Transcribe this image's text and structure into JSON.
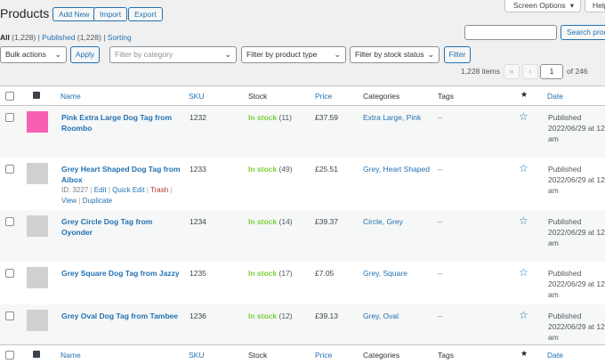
{
  "header": {
    "title": "Products",
    "add_new": "Add New",
    "import": "Import",
    "export": "Export",
    "screen_options": "Screen Options",
    "help": "Help"
  },
  "views": {
    "all": "All",
    "all_count": "(1,228)",
    "published": "Published",
    "published_count": "(1,228)",
    "sorting": "Sorting",
    "sep": "|"
  },
  "search": {
    "placeholder": "",
    "button": "Search products"
  },
  "filters": {
    "bulk": "Bulk actions",
    "apply": "Apply",
    "category": "Filter by category",
    "product_type": "Filter by product type",
    "stock_status": "Filter by stock status",
    "filter": "Filter"
  },
  "pagination": {
    "items": "1,228 items",
    "first": "«",
    "prev": "‹",
    "current": "1",
    "of": "of 246"
  },
  "columns": {
    "name": "Name",
    "sku": "SKU",
    "stock": "Stock",
    "price": "Price",
    "categories": "Categories",
    "tags": "Tags",
    "featured_icon": "star-filled-icon",
    "date": "Date"
  },
  "colors": {
    "accent": "#2271b1",
    "in_stock": "#7ad03a",
    "trash": "#b32d2e",
    "pink_thumb": "#f75fb3",
    "grey_thumb": "#d0d0d0"
  },
  "products": [
    {
      "name": "Pink Extra Large Dog Tag from Roombo",
      "sku": "1232",
      "stock_label": "In stock",
      "stock_qty": "(11)",
      "price": "£37.59",
      "categories": "Extra Large, Pink",
      "tags": "–",
      "date_status": "Published",
      "date": "2022/06/29 at 12:",
      "date_suffix": "am"
    },
    {
      "name": "Grey Heart Shaped Dog Tag from Aibox",
      "sku": "1233",
      "stock_label": "In stock",
      "stock_qty": "(49)",
      "price": "£25.51",
      "categories": "Grey, Heart Shaped",
      "tags": "–",
      "date_status": "Published",
      "date": "2022/06/29 at 12:",
      "date_suffix": "am",
      "row_actions": {
        "id": "ID: 3227",
        "edit": "Edit",
        "quick_edit": "Quick Edit",
        "trash": "Trash",
        "view": "View",
        "duplicate": "Duplicate"
      }
    },
    {
      "name": "Grey Circle Dog Tag from Oyonder",
      "sku": "1234",
      "stock_label": "In stock",
      "stock_qty": "(14)",
      "price": "£39.37",
      "categories": "Circle, Grey",
      "tags": "–",
      "date_status": "Published",
      "date": "2022/06/29 at 12:",
      "date_suffix": "am"
    },
    {
      "name": "Grey Square Dog Tag from Jazzy",
      "sku": "1235",
      "stock_label": "In stock",
      "stock_qty": "(17)",
      "price": "£7.05",
      "categories": "Grey, Square",
      "tags": "–",
      "date_status": "Published",
      "date": "2022/06/29 at 12:",
      "date_suffix": "am"
    },
    {
      "name": "Grey Oval Dog Tag from Tambee",
      "sku": "1236",
      "stock_label": "In stock",
      "stock_qty": "(12)",
      "price": "£39.13",
      "categories": "Grey, Oval",
      "tags": "–",
      "date_status": "Published",
      "date": "2022/06/29 at 12:",
      "date_suffix": "am"
    }
  ]
}
